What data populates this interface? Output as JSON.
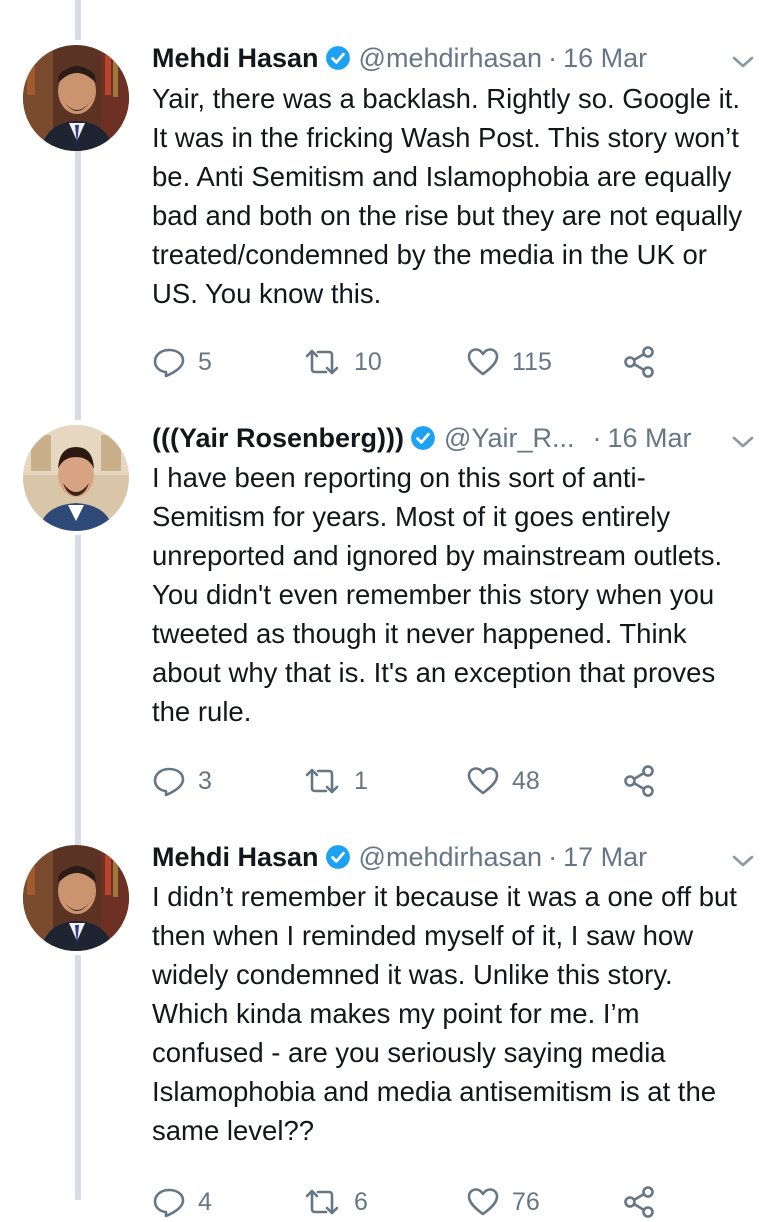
{
  "tweets": [
    {
      "name": "Mehdi Hasan",
      "handle": "@mehdirhasan",
      "separator": "·",
      "date": "16 Mar",
      "text": "Yair, there was a backlash. Rightly so. Google it. It was in the fricking Wash Post. This story won’t be. Anti Semitism and Islamophobia are equally bad and both on the rise but they are not equally treated/condemned by the media in the UK or US. You know this.",
      "replies": "5",
      "retweets": "10",
      "likes": "115",
      "avatar": "mehdi-hasan-photo",
      "verified": true
    },
    {
      "name": "(((Yair Rosenberg)))",
      "handle": "@Yair_R...",
      "separator": "·",
      "date": "16 Mar",
      "text": "I have been reporting on this sort of anti-Semitism for years. Most of it goes entirely unreported and ignored by mainstream outlets. You didn't even remember this story when you tweeted as though it never happened. Think about why that is. It's an exception that proves the rule.",
      "replies": "3",
      "retweets": "1",
      "likes": "48",
      "avatar": "yair-rosenberg-photo",
      "verified": true
    },
    {
      "name": "Mehdi Hasan",
      "handle": "@mehdirhasan",
      "separator": "·",
      "date": "17 Mar",
      "text": "I didn’t remember it because it was a one off but then when I reminded myself of it, I saw how widely condemned it was. Unlike this story. Which kinda makes my point for me. I’m confused - are you seriously saying media Islamophobia and media antisemitism is at the same level??",
      "replies": "4",
      "retweets": "6",
      "likes": "76",
      "avatar": "mehdi-hasan-photo",
      "verified": true
    }
  ],
  "icons": {
    "reply": "reply-icon",
    "retweet": "retweet-icon",
    "like": "heart-icon",
    "share": "share-icon",
    "menu": "chevron-down-icon",
    "verified": "verified-badge-icon"
  },
  "colors": {
    "verified": "#1da1f2",
    "secondary_text": "#657786",
    "thread_line": "#d6dde3",
    "primary_text": "#14171a"
  }
}
